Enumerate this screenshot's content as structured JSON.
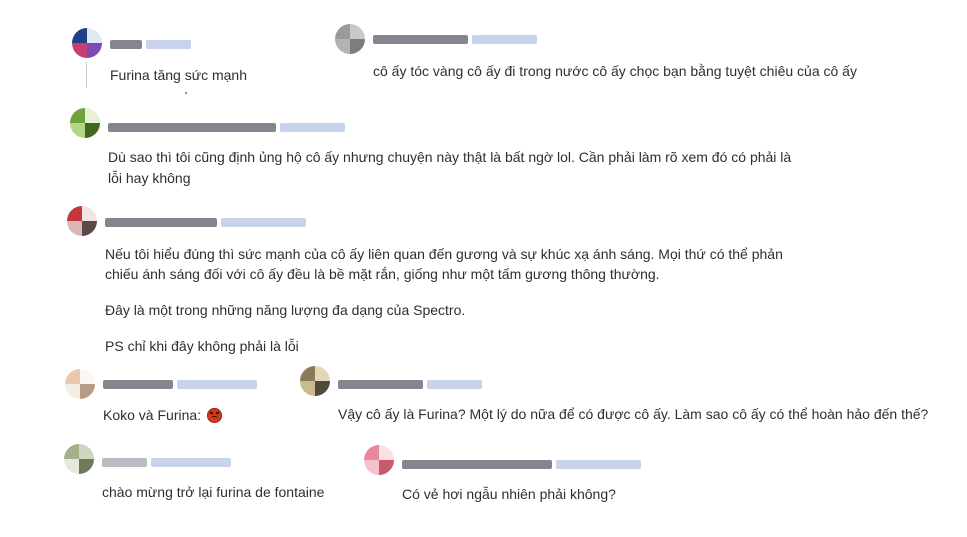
{
  "comments": [
    {
      "id": "c1",
      "text": "Furina tăng sức mạnh",
      "avatar_colors": [
        "#1f3f8a",
        "#c93f6f",
        "#e3e7f5",
        "#7a4bb0"
      ]
    },
    {
      "id": "c2",
      "text": "cô ấy tóc vàng cô ấy đi trong nước cô ấy chọc bạn bằng tuyệt chiêu của cô ấy",
      "avatar_colors": [
        "#9a9a9a",
        "#c9c9c9",
        "#7d7d7d",
        "#b3b3b3"
      ]
    },
    {
      "id": "c3",
      "lines": [
        "Dù sao thì tôi cũng định ủng hộ cô ấy nhưng chuyện này thật là bất ngờ lol. Cần phải làm rõ xem đó có phải là",
        "lỗi hay không"
      ],
      "avatar_colors": [
        "#6ea33a",
        "#e8f0d8",
        "#3e6a1f",
        "#b6d48a"
      ]
    },
    {
      "id": "c4",
      "paragraphs": [
        [
          "Nếu tôi hiểu đúng thì sức mạnh của cô ấy liên quan đến gương và sự khúc xạ ánh sáng. Mọi thứ có thể phản",
          "chiếu ánh sáng đối với cô ấy đều là bề mặt rắn, giống như một tấm gương thông thường."
        ],
        [
          "Đây là một trong những năng lượng đa dạng của Spectro."
        ],
        [
          "PS chỉ khi đây không phải là lỗi"
        ]
      ],
      "avatar_colors": [
        "#c4363b",
        "#d9b9b3",
        "#5c4a49",
        "#f0e5e2"
      ]
    },
    {
      "id": "c5",
      "text": "Koko và Furina:",
      "emoji": "angry-face",
      "avatar_colors": [
        "#e8c9b0",
        "#f5ede3",
        "#b99a84",
        "#fbf6f0"
      ]
    },
    {
      "id": "c6",
      "text": "Vậy cô ấy là Furina? Một lý do nữa để có được cô ấy. Làm sao cô ấy có thể hoàn hảo đến thế?",
      "avatar_colors": [
        "#8a7a5a",
        "#c9b98e",
        "#4f4a3a",
        "#e2d7b9"
      ]
    },
    {
      "id": "c7",
      "text": "chào mừng trở lại furina de fontaine",
      "avatar_colors": [
        "#a5b08c",
        "#e6eadb",
        "#6f7a5a",
        "#cfd6bf"
      ]
    },
    {
      "id": "c8",
      "text": "Có vẻ hơi ngẫu nhiên phải không?",
      "avatar_colors": [
        "#e6899a",
        "#f4c2cb",
        "#c85a6e",
        "#fbe0e5"
      ]
    }
  ]
}
